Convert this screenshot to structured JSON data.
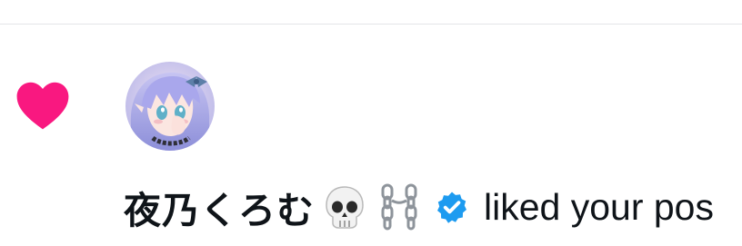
{
  "notification": {
    "type_icon": "heart-icon",
    "user": {
      "avatar": "anime-girl-avatar",
      "display_name": "夜乃くろむ",
      "name_emojis": [
        "skull-emoji",
        "chains-emoji"
      ],
      "verified": true
    },
    "action_text": "liked your pos"
  },
  "colors": {
    "heart": "#f91880",
    "verified": "#1d9bf0",
    "text": "#0f1419",
    "divider": "#e3e5e8"
  }
}
